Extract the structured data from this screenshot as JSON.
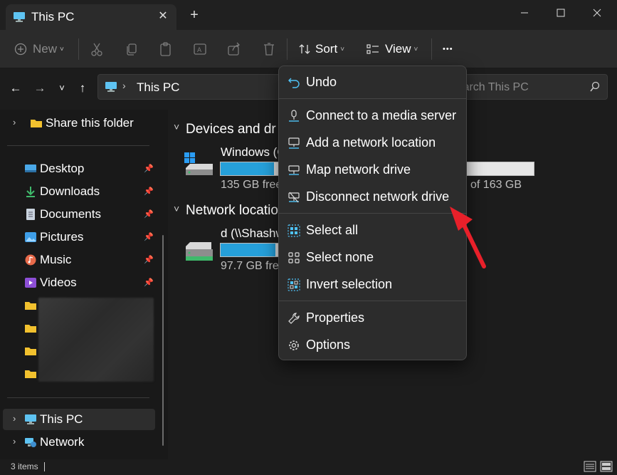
{
  "window": {
    "tab_title": "This PC",
    "tab_icon": "monitor-icon",
    "close_tab_glyph": "✕",
    "new_tab_glyph": "+"
  },
  "commandbar": {
    "new_label": "New",
    "sort_label": "Sort",
    "view_label": "View",
    "more_glyph": "•••"
  },
  "address": {
    "location": "This PC",
    "search_placeholder": "Search This PC"
  },
  "sidebar": {
    "share_item": "Share this folder",
    "quick_access": [
      {
        "label": "Desktop",
        "icon": "desktop-icon"
      },
      {
        "label": "Downloads",
        "icon": "download-icon"
      },
      {
        "label": "Documents",
        "icon": "document-icon"
      },
      {
        "label": "Pictures",
        "icon": "pictures-icon"
      },
      {
        "label": "Music",
        "icon": "music-icon"
      },
      {
        "label": "Videos",
        "icon": "videos-icon"
      }
    ],
    "this_pc": "This PC",
    "network": "Network"
  },
  "main": {
    "devices_group": "Devices and dr",
    "network_group": "Network locatio",
    "drive_c": {
      "name": "Windows (C",
      "info_left": "135 GB free",
      "info_right": "of 163 GB",
      "used_fraction": 0.17
    },
    "drive_d": {
      "name": "d (\\\\Shashw",
      "info_left": "97.7 GB free",
      "used_fraction": 0.55
    }
  },
  "menu": {
    "undo": "Undo",
    "connect_media": "Connect to a media server",
    "add_network": "Add a network location",
    "map_drive": "Map network drive",
    "disconnect_drive": "Disconnect network drive",
    "select_all": "Select all",
    "select_none": "Select none",
    "invert_selection": "Invert selection",
    "properties": "Properties",
    "options": "Options"
  },
  "status": {
    "items_count": "3 items"
  },
  "colors": {
    "accent": "#26a0da",
    "annotation_arrow": "#e8202a",
    "folder": "#f2c12e"
  }
}
